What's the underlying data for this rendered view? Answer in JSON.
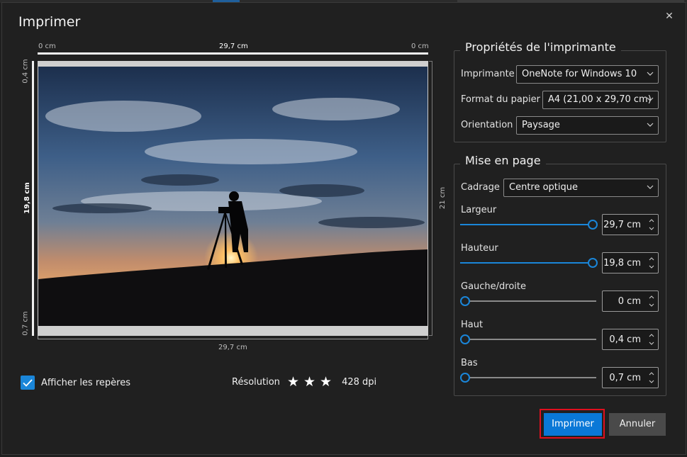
{
  "dialog": {
    "title": "Imprimer",
    "close_icon": "close-icon"
  },
  "preview": {
    "ruler_top": {
      "left": "0 cm",
      "center": "29,7 cm",
      "right": "0 cm"
    },
    "ruler_left": {
      "top": "0,4 cm",
      "center": "19,8 cm",
      "bottom": "0,7 cm"
    },
    "ruler_right": "21 cm",
    "ruler_bottom": "29,7 cm"
  },
  "options": {
    "show_guides_label": "Afficher les repères",
    "show_guides_checked": true
  },
  "resolution": {
    "label": "Résolution",
    "stars": 3,
    "value": "428 dpi"
  },
  "printer_properties": {
    "legend": "Propriétés de l'imprimante",
    "printer_label": "Imprimante",
    "printer_value": "OneNote for Windows 10",
    "paper_label": "Format du papier",
    "paper_value": "A4 (21,00 x 29,70 cm)",
    "orientation_label": "Orientation",
    "orientation_value": "Paysage"
  },
  "layout": {
    "legend": "Mise en page",
    "crop_label": "Cadrage",
    "crop_value": "Centre optique",
    "width": {
      "label": "Largeur",
      "value": "29,7 cm",
      "level": 1.0
    },
    "height": {
      "label": "Hauteur",
      "value": "19,8 cm",
      "level": 1.0
    },
    "leftright": {
      "label": "Gauche/droite",
      "value": "0 cm",
      "level": 0.0
    },
    "top": {
      "label": "Haut",
      "value": "0,4 cm",
      "level": 0.0
    },
    "bottom": {
      "label": "Bas",
      "value": "0,7 cm",
      "level": 0.0
    }
  },
  "buttons": {
    "print": "Imprimer",
    "cancel": "Annuler"
  },
  "colors": {
    "accent": "#0a78d7",
    "focus": "#e00f1e",
    "background": "#202020"
  }
}
